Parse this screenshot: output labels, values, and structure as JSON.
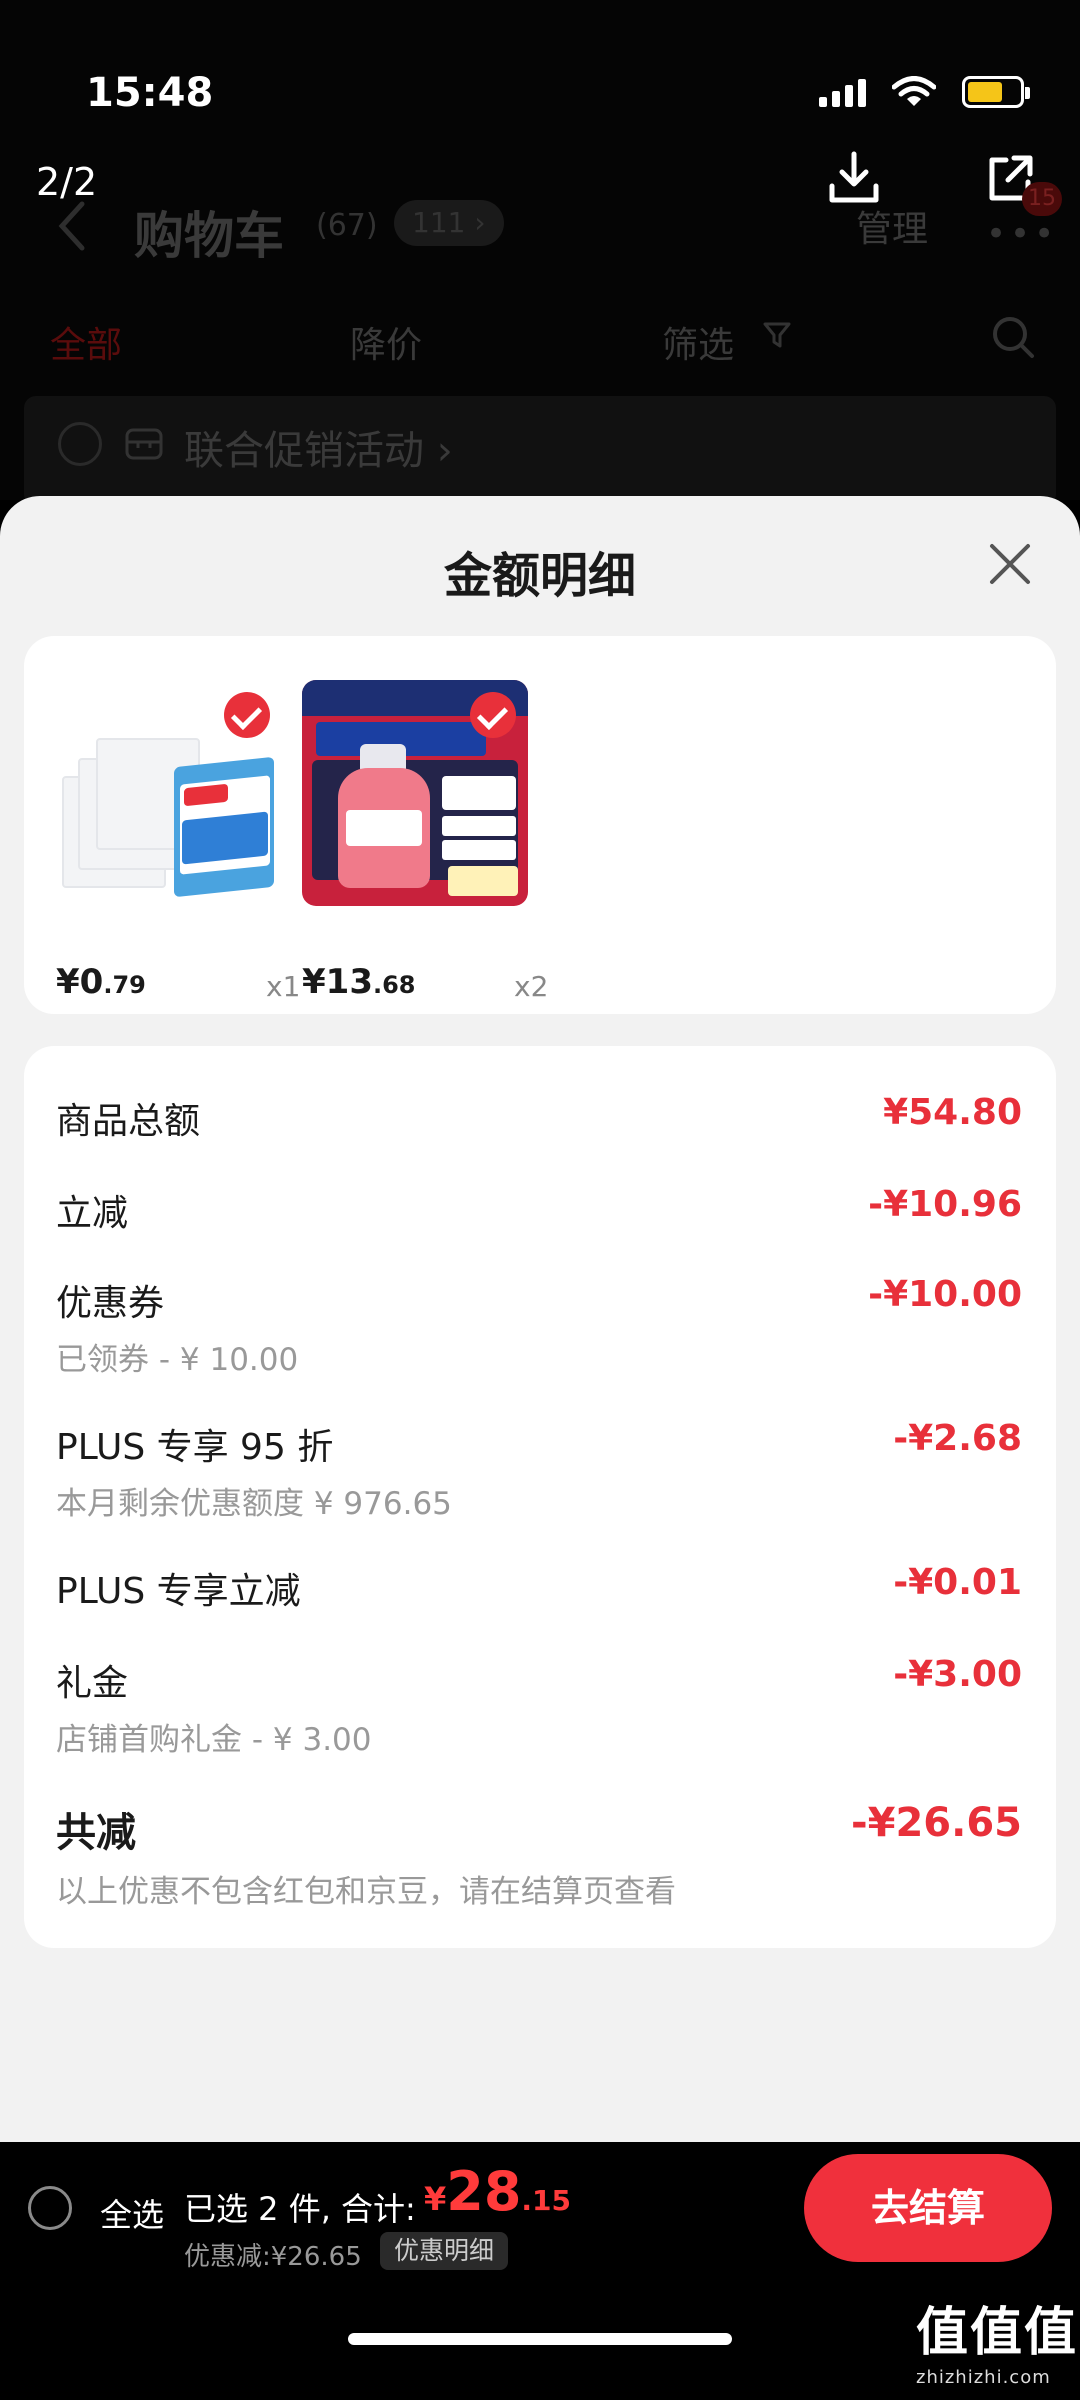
{
  "status_bar": {
    "time": "15:48"
  },
  "viewer": {
    "counter": "2/2"
  },
  "background_page": {
    "title": "购物车",
    "count": "(67)",
    "pill": "111 ›",
    "manage": "管理",
    "badge": "15",
    "tabs": [
      "全部",
      "降价",
      "筛选"
    ],
    "promo": "联合促销活动 ›"
  },
  "sheet": {
    "title": "金额明细",
    "products": [
      {
        "price_main": "¥0",
        "price_dec": ".79",
        "qty": "x1",
        "image": "sponge-product"
      },
      {
        "price_main": "¥13",
        "price_dec": ".68",
        "qty": "x2",
        "image": "mouthwash-product"
      }
    ],
    "rows": [
      {
        "label": "商品总额",
        "value": "¥54.80",
        "sub": ""
      },
      {
        "label": "立减",
        "value": "-¥10.96",
        "sub": ""
      },
      {
        "label": "优惠券",
        "value": "-¥10.00",
        "sub": "已领券 - ¥ 10.00"
      },
      {
        "label": "PLUS 专享 95 折",
        "value": "-¥2.68",
        "sub": "本月剩余优惠额度 ¥ 976.65"
      },
      {
        "label": "PLUS 专享立减",
        "value": "-¥0.01",
        "sub": ""
      },
      {
        "label": "礼金",
        "value": "-¥3.00",
        "sub": "店铺首购礼金 - ¥ 3.00"
      }
    ],
    "total": {
      "label": "共减",
      "value": "-¥26.65",
      "note": "以上优惠不包含红包和京豆，请在结算页查看"
    }
  },
  "bottom_bar": {
    "select_all": "全选",
    "selected": "已选 2 件, 合计:",
    "amount_yen": "¥",
    "amount_int": "28",
    "amount_dec": ".15",
    "saved": "优惠减:¥26.65",
    "detail_link": "优惠明细",
    "checkout": "去结算"
  },
  "watermark": {
    "big": "值值值",
    "small": "zhizhizhi.com"
  },
  "colors": {
    "accent": "#e8303a",
    "checkout": "#f0303c",
    "sheet_bg": "#f2f2f2"
  }
}
